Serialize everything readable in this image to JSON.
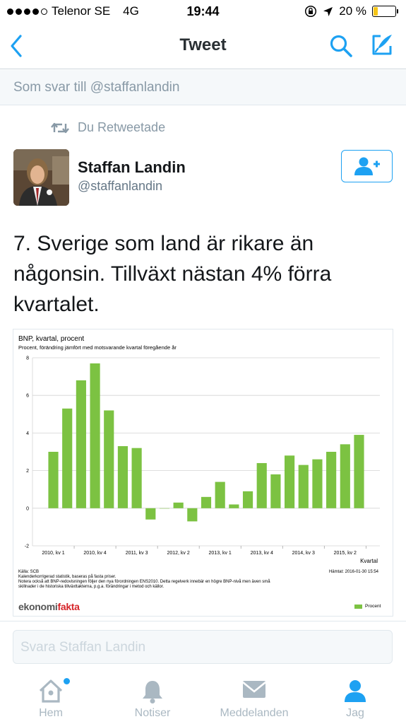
{
  "status_bar": {
    "carrier": "Telenor SE",
    "network": "4G",
    "time": "19:44",
    "battery_percent_label": "20 %",
    "battery_level": 0.2,
    "signal_bars": 4
  },
  "nav": {
    "title": "Tweet",
    "back_icon": "chevron-left-icon",
    "search_icon": "search-icon",
    "compose_icon": "compose-icon",
    "accent": "#1da1f2"
  },
  "reply_context": {
    "text": "Som svar till @staffanlandin"
  },
  "retweet": {
    "text": "Du Retweetade",
    "icon": "retweet-icon"
  },
  "author": {
    "name": "Staffan Landin",
    "handle": "@staffanlandin",
    "follow_icon": "add-user-icon"
  },
  "tweet": {
    "text": "7. Sverige som land är rikare än någonsin. Tillväxt nästan 4% förra kvartalet."
  },
  "media": {
    "footer_notes": [
      "Källa: SCB",
      "Kalenderkorrigerad statistik, baseras på fasta priser.",
      "Notera också att BNP-redovisningen följer den nya förordningen ENS2010. Detta regelverk innebär en högre BNP-nivå men även små",
      "skillnader i de historiska tillväxttakterna, p.g.a. förändringar i metod och källor."
    ],
    "retrieved": "Hämtat: 2016-01-30 15:54",
    "logo_part1": "ekonomi",
    "logo_part2": "fakta"
  },
  "chart_data": {
    "type": "bar",
    "title": "BNP, kvartal, procent",
    "subtitle": "Procent, förändring jämfört med motsvarande kvartal föregående år",
    "xlabel": "Kvartal",
    "ylabel": "",
    "ylim": [
      -2,
      8
    ],
    "yticks": [
      -2,
      0,
      2,
      4,
      6,
      8
    ],
    "grid": true,
    "legend_position": "bottom-right",
    "color": "#7cc242",
    "x_tick_labels": [
      "2010, kv 1",
      "2010, kv 4",
      "2011, kv 3",
      "2012, kv 2",
      "2013, kv 1",
      "2013, kv 4",
      "2014, kv 3",
      "2015, kv 2"
    ],
    "categories": [
      "2010, kv 1",
      "2010, kv 2",
      "2010, kv 3",
      "2010, kv 4",
      "2011, kv 1",
      "2011, kv 2",
      "2011, kv 3",
      "2011, kv 4",
      "2012, kv 1",
      "2012, kv 2",
      "2012, kv 3",
      "2012, kv 4",
      "2013, kv 1",
      "2013, kv 2",
      "2013, kv 3",
      "2013, kv 4",
      "2014, kv 1",
      "2014, kv 2",
      "2014, kv 3",
      "2014, kv 4",
      "2015, kv 1",
      "2015, kv 2",
      "2015, kv 3"
    ],
    "series": [
      {
        "name": "Procent",
        "values": [
          3.0,
          5.3,
          6.8,
          7.7,
          5.2,
          3.3,
          3.2,
          -0.6,
          0.0,
          0.3,
          -0.7,
          0.6,
          1.4,
          0.2,
          0.9,
          2.4,
          1.8,
          2.8,
          2.3,
          2.6,
          3.0,
          3.4,
          3.9
        ]
      }
    ]
  },
  "reply_input": {
    "placeholder": "Svara Staffan Landin"
  },
  "tabbar": {
    "tabs": [
      {
        "label": "Hem",
        "icon": "home-icon",
        "active": false,
        "has_dot": true
      },
      {
        "label": "Notiser",
        "icon": "bell-icon",
        "active": false
      },
      {
        "label": "Meddelanden",
        "icon": "envelope-icon",
        "active": false
      },
      {
        "label": "Jag",
        "icon": "user-icon",
        "active": true
      }
    ]
  }
}
